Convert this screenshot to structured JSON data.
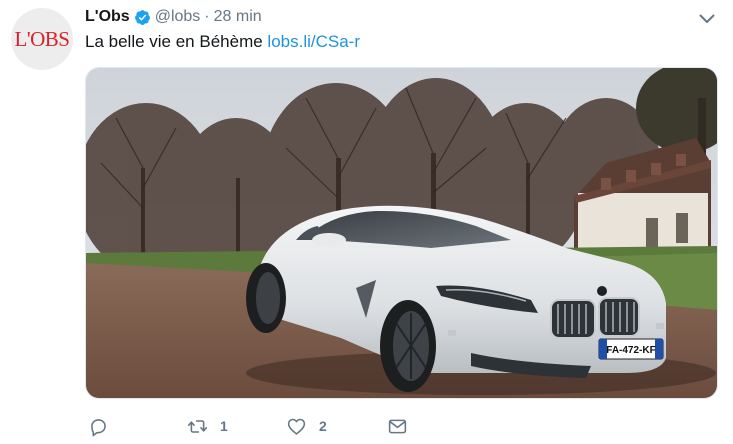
{
  "tweet": {
    "author": {
      "name": "L'Obs",
      "handle": "@lobs",
      "verified": true,
      "avatar_text": "L'OBS"
    },
    "separator": "·",
    "time": "28 min",
    "text": "La belle vie en Béhème",
    "link": "lobs.li/CSa-r",
    "media": {
      "license_plate": "FA-472-KF"
    },
    "actions": {
      "reply": {
        "icon": "reply-icon",
        "count": ""
      },
      "retweet": {
        "icon": "retweet-icon",
        "count": "1"
      },
      "like": {
        "icon": "heart-icon",
        "count": "2"
      },
      "message": {
        "icon": "envelope-icon",
        "count": ""
      }
    }
  },
  "colors": {
    "link": "#1b95e0",
    "muted": "#657786",
    "verified": "#1da1f2",
    "brand_red": "#d8232a"
  }
}
